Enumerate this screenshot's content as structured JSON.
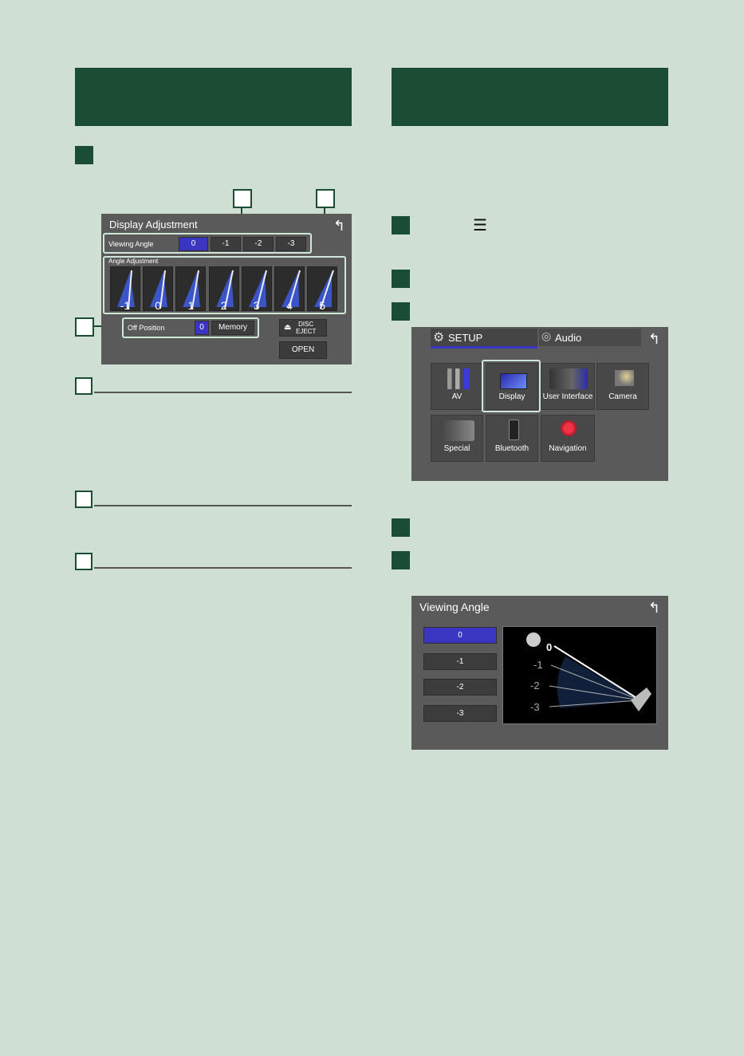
{
  "display_adjustment": {
    "title": "Display Adjustment",
    "viewing_angle_label": "Viewing Angle",
    "viewing_angle_options": [
      "0",
      "-1",
      "-2",
      "-3"
    ],
    "angle_adjustment_label": "Angle Adjustment",
    "angle_values": [
      "-1",
      "0",
      "1",
      "2",
      "3",
      "4",
      "5"
    ],
    "off_position_label": "Off Position",
    "off_position_value": "0",
    "memory_label": "Memory",
    "disc_eject_label": "DISC\nEJECT",
    "open_label": "OPEN"
  },
  "setup_menu": {
    "tab_setup": "SETUP",
    "tab_audio": "Audio",
    "items": [
      "AV",
      "Display",
      "User Interface",
      "Camera",
      "Special",
      "Bluetooth",
      "Navigation"
    ]
  },
  "viewing_angle": {
    "title": "Viewing Angle",
    "options": [
      "0",
      "-1",
      "-2",
      "-3"
    ],
    "diagram_labels": [
      "0",
      "-1",
      "-2",
      "-3"
    ]
  },
  "colors": {
    "header_green": "#1b4d35",
    "background": "#cfdfd3",
    "selected_blue": "#3a36c2"
  },
  "icons": {
    "menu": "☰",
    "back": "↰",
    "eject": "⏏"
  }
}
